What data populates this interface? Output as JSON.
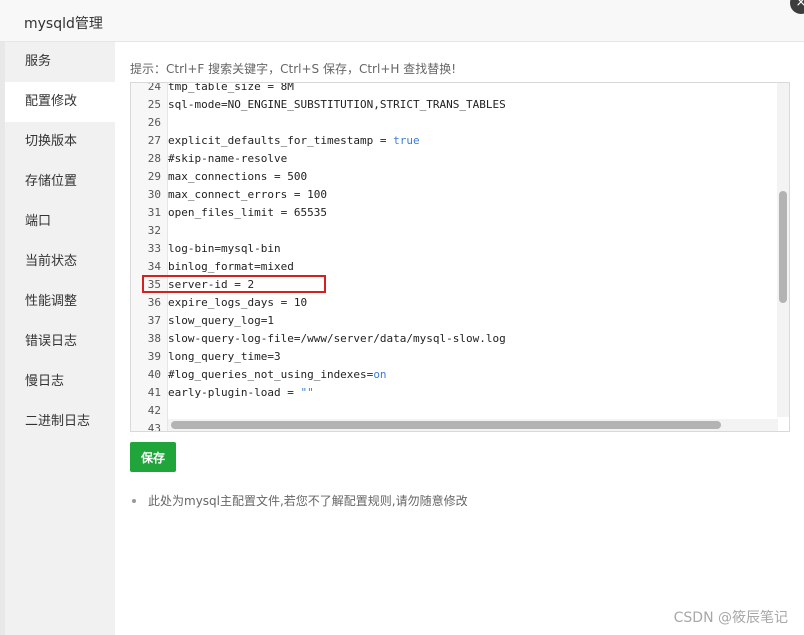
{
  "dialog": {
    "title": "mysqld管理",
    "close_icon": "×"
  },
  "sidebar": {
    "items": [
      {
        "label": "服务"
      },
      {
        "label": "配置修改",
        "active": true
      },
      {
        "label": "切换版本"
      },
      {
        "label": "存储位置"
      },
      {
        "label": "端口"
      },
      {
        "label": "当前状态"
      },
      {
        "label": "性能调整"
      },
      {
        "label": "错误日志"
      },
      {
        "label": "慢日志"
      },
      {
        "label": "二进制日志"
      }
    ]
  },
  "main": {
    "hint": "提示：Ctrl+F 搜索关键字，Ctrl+S 保存，Ctrl+H 查找替换!",
    "save_label": "保存",
    "note": "此处为mysql主配置文件,若您不了解配置规则,请勿随意修改"
  },
  "editor": {
    "highlighted_line": "35",
    "lines": [
      {
        "n": "24",
        "text": "tmp_table_size = 8M"
      },
      {
        "n": "25",
        "text": "sql-mode=NO_ENGINE_SUBSTITUTION,STRICT_TRANS_TABLES"
      },
      {
        "n": "26",
        "text": ""
      },
      {
        "n": "27",
        "text": "explicit_defaults_for_timestamp = ",
        "kw": "true"
      },
      {
        "n": "28",
        "text": "#skip-name-resolve"
      },
      {
        "n": "29",
        "text": "max_connections = 500"
      },
      {
        "n": "30",
        "text": "max_connect_errors = 100"
      },
      {
        "n": "31",
        "text": "open_files_limit = 65535"
      },
      {
        "n": "32",
        "text": ""
      },
      {
        "n": "33",
        "text": "log-bin=mysql-bin"
      },
      {
        "n": "34",
        "text": "binlog_format=mixed"
      },
      {
        "n": "35",
        "text": "server-id = 2"
      },
      {
        "n": "36",
        "text": "expire_logs_days = 10"
      },
      {
        "n": "37",
        "text": "slow_query_log=1"
      },
      {
        "n": "38",
        "text": "slow-query-log-file=/www/server/data/mysql-slow.log"
      },
      {
        "n": "39",
        "text": "long_query_time=3"
      },
      {
        "n": "40",
        "text": "#log_queries_not_using_indexes=",
        "kw": "on"
      },
      {
        "n": "41",
        "text": "early-plugin-load = ",
        "kw": "\"\""
      },
      {
        "n": "42",
        "text": ""
      },
      {
        "n": "43",
        "text": ""
      }
    ]
  },
  "watermark": "CSDN @筱辰笔记"
}
